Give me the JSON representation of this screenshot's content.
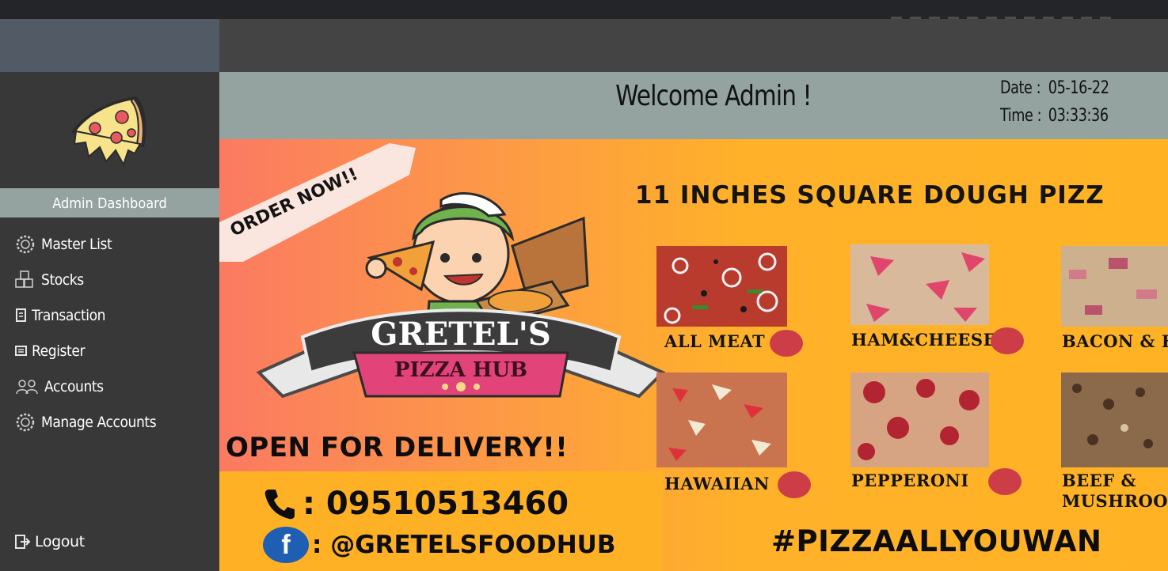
{
  "header": {
    "welcome": "Welcome Admin !",
    "date_label": "Date :",
    "date_value": "05-16-22",
    "time_label": "Time :",
    "time_value": "03:33:36"
  },
  "sidebar": {
    "title": "Admin Dashboard",
    "items": [
      {
        "label": "Master List",
        "icon": "gear-icon"
      },
      {
        "label": "Stocks",
        "icon": "boxes-icon"
      },
      {
        "label": "Transaction",
        "icon": "receipt-icon"
      },
      {
        "label": "Register",
        "icon": "register-icon"
      },
      {
        "label": "Accounts",
        "icon": "users-icon"
      },
      {
        "label": "Manage Accounts",
        "icon": "gear-icon"
      }
    ],
    "logout": "Logout"
  },
  "banner": {
    "order_now": "ORDER NOW!!",
    "brand_top": "GRETEL'S",
    "brand_bottom": "PIZZA HUB",
    "heading": "11 INCHES SQUARE DOUGH PIZZ",
    "pizzas": [
      "ALL MEAT",
      "HAM&CHEESE",
      "BACON & H",
      "HAWAIIAN",
      "PEPPERONI",
      "BEEF &",
      "MUSHROO"
    ],
    "open_delivery": "OPEN FOR DELIVERY!!",
    "phone": ": 09510513460",
    "facebook": ": @GRETELSFOODHUB",
    "hashtag": "#PIZZAALLYOUWAN",
    "colors": {
      "accent_red": "#cc3d47",
      "banner_yellow": "#ffb12a",
      "banner_coral": "#fb7a62"
    }
  }
}
